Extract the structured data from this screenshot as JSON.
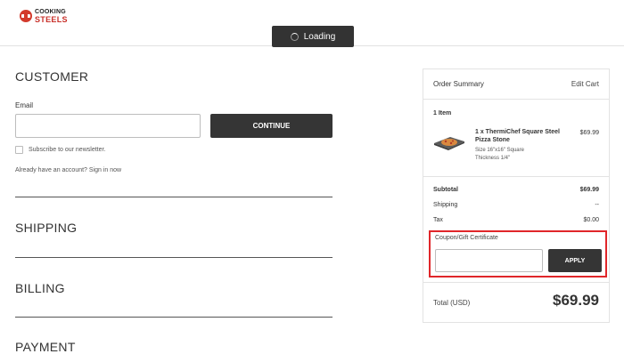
{
  "header": {
    "logo_top": "COOKING",
    "logo_bottom": "STEELS",
    "loading_label": "Loading",
    "brand_color": "#c8302a"
  },
  "checkout": {
    "customer": {
      "title": "CUSTOMER",
      "email_label": "Email",
      "email_value": "",
      "continue_label": "CONTINUE",
      "subscribe_label": "Subscribe to our newsletter.",
      "subscribe_checked": false,
      "signin_text": "Already have an account? Sign in now"
    },
    "shipping_title": "SHIPPING",
    "billing_title": "BILLING",
    "payment_title": "PAYMENT"
  },
  "summary": {
    "title": "Order Summary",
    "edit_cart": "Edit Cart",
    "item_count": "1 Item",
    "product": {
      "name": "1 x ThermiChef Square Steel Pizza Stone",
      "price": "$69.99",
      "options": [
        "Size 16\"x16\" Square",
        "Thickness 1/4\""
      ],
      "icon": "pizza-stone-thumbnail"
    },
    "subtotal_label": "Subtotal",
    "subtotal_value": "$69.99",
    "shipping_label": "Shipping",
    "shipping_value": "--",
    "tax_label": "Tax",
    "tax_value": "$0.00",
    "coupon_label": "Coupon/Gift Certificate",
    "coupon_value": "",
    "apply_label": "APPLY",
    "highlight_color": "#e0262a",
    "total_label": "Total (USD)",
    "total_value": "$69.99"
  }
}
